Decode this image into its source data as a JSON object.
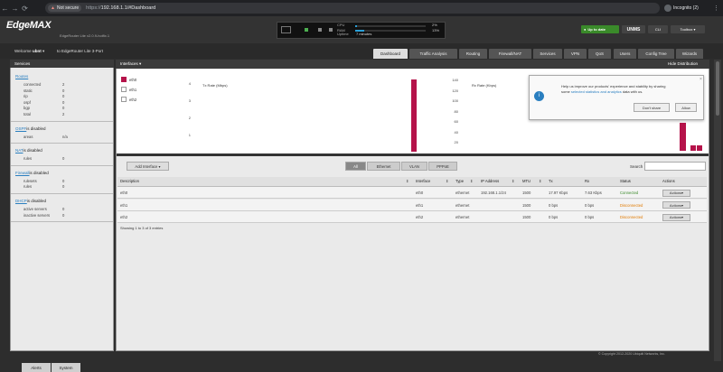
{
  "browser": {
    "not_secure": "Not secure",
    "url_scheme": "https://",
    "url_rest": "192.168.1.1/#Dashboard",
    "incognito": "Incognito (2)"
  },
  "header": {
    "logo": "EdgeMAX",
    "version": "EdgeRouter Lite v2.0.9-hotfix.1",
    "cpu_label": "CPU",
    "cpu_value": "2%",
    "ram_label": "RAM",
    "ram_value": "13%",
    "ram_fraction": 0.13,
    "uptime_label": "Uptime",
    "uptime_value": "7 minutes",
    "up_to_date": "Up to date",
    "unms": "UNMS",
    "cli": "CLI",
    "toolbox": "Toolbox"
  },
  "user": {
    "welcome": "Welcome",
    "name": "ubnt",
    "port_prefix": "to EdgeRouter Lite 3-Port"
  },
  "tabs": [
    "Dashboard",
    "Traffic Analysis",
    "Routing",
    "Firewall/NAT",
    "Services",
    "VPN",
    "QoS",
    "Users",
    "Config Tree",
    "Wizards"
  ],
  "services": {
    "title": "Services",
    "routes": {
      "link": "Routes",
      "rows": [
        [
          "connected",
          "2"
        ],
        [
          "static",
          "0"
        ],
        [
          "rip",
          "0"
        ],
        [
          "ospf",
          "0"
        ],
        [
          "bgp",
          "0"
        ],
        [
          "total",
          "2"
        ]
      ]
    },
    "ospf": {
      "link": "OSPF",
      "status": "is disabled",
      "rows": [
        [
          "areas",
          "n/a"
        ]
      ]
    },
    "nat": {
      "link": "NAT",
      "status": "is disabled",
      "rows": [
        [
          "rules",
          "0"
        ]
      ]
    },
    "firewall": {
      "link": "Firewall",
      "status": "is disabled",
      "rows": [
        [
          "rulesets",
          "0"
        ],
        [
          "rules",
          "0"
        ]
      ]
    },
    "dhcp": {
      "link": "DHCP",
      "status": "is disabled",
      "rows": [
        [
          "active servers",
          "0"
        ],
        [
          "inactive servers",
          "0"
        ]
      ]
    }
  },
  "interfaces_panel": {
    "title": "Interfaces",
    "hide": "Hide Distribution",
    "legend": [
      "eth0",
      "eth1",
      "eth2"
    ],
    "tx_title": "Tx Rate (Mbps)",
    "rx_title": "Rx Rate (Kbps)",
    "tx_ticks": [
      "4",
      "3",
      "2",
      "1"
    ],
    "rx_ticks": [
      "140",
      "120",
      "100",
      "80",
      "60",
      "40",
      "20"
    ]
  },
  "popup": {
    "text_1": "Help us improve our products' experience and stability by sharing",
    "text_2_prefix": "some",
    "text_2_link": "selected statistics and analytics",
    "text_2_suffix": "data with us.",
    "dont_share": "Don't share",
    "allow": "Allow"
  },
  "table": {
    "add_interface": "Add Interface",
    "filters": [
      "All",
      "Ethernet",
      "VLAN",
      "PPPoE"
    ],
    "search_label": "Search",
    "headers": [
      "Description",
      "Interface",
      "Type",
      "IP Address",
      "MTU",
      "Tx",
      "Rx",
      "Status",
      "Actions"
    ],
    "rows": [
      [
        "eth0",
        "eth0",
        "ethernet",
        "192.168.1.1/24",
        "1500",
        "17.97 Kbps",
        "7.63 Kbps",
        "Connected"
      ],
      [
        "eth1",
        "eth1",
        "ethernet",
        "",
        "1500",
        "0 bps",
        "0 bps",
        "Disconnected"
      ],
      [
        "eth2",
        "eth2",
        "ethernet",
        "",
        "1500",
        "0 bps",
        "0 bps",
        "Disconnected"
      ]
    ],
    "actions_label": "Actions",
    "showing": "Showing 1 to 3 of 3 entries"
  },
  "footer": {
    "copyright": "© Copyright 2012-2020 Ubiquiti Networks, Inc.",
    "tabs": [
      "Alerts",
      "System"
    ]
  },
  "colors": {
    "accent": "#b5134a",
    "ok": "#3a8a2a",
    "warn": "#e07a00"
  }
}
